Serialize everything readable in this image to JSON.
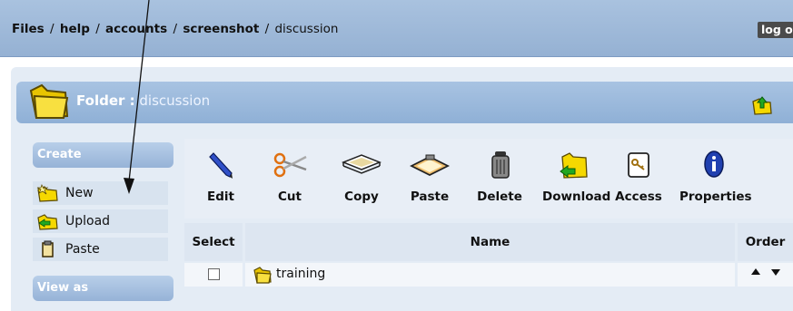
{
  "breadcrumb": {
    "items": [
      "Files",
      "help",
      "accounts",
      "screenshot"
    ],
    "current": "discussion",
    "separator": "/"
  },
  "header": {
    "logout_label": "log out"
  },
  "folder": {
    "prefix": "Folder :",
    "name": "discussion"
  },
  "sidebar": {
    "create_heading": "Create",
    "create_items": [
      {
        "label": "New",
        "icon": "new-folder-icon"
      },
      {
        "label": "Upload",
        "icon": "upload-icon"
      },
      {
        "label": "Paste",
        "icon": "clipboard-icon"
      }
    ],
    "view_heading": "View as"
  },
  "toolbar": {
    "items": [
      {
        "label": "Edit",
        "icon": "pencil-icon"
      },
      {
        "label": "Cut",
        "icon": "scissors-icon"
      },
      {
        "label": "Copy",
        "icon": "copy-icon"
      },
      {
        "label": "Paste",
        "icon": "paste-icon"
      },
      {
        "label": "Delete",
        "icon": "trash-icon"
      },
      {
        "label": "Download",
        "icon": "download-icon"
      },
      {
        "label": "Access",
        "icon": "key-icon"
      },
      {
        "label": "Properties",
        "icon": "info-icon"
      }
    ]
  },
  "table": {
    "columns": [
      "Select",
      "Name",
      "Order"
    ],
    "rows": [
      {
        "name": "training",
        "checked": false
      }
    ]
  },
  "colors": {
    "header_blue": "#a9c2df",
    "panel_bg": "#e4ecf5",
    "logout_bg": "#4b4b4b",
    "folder_yellow": "#f5d800"
  }
}
